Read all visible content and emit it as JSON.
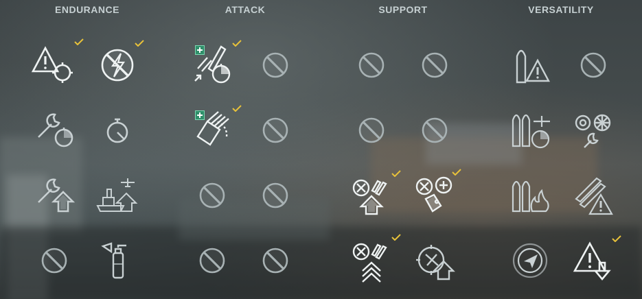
{
  "columns": [
    {
      "label": "ENDURANCE"
    },
    {
      "label": "ATTACK"
    },
    {
      "label": "SUPPORT"
    },
    {
      "label": "VERSATILITY"
    }
  ],
  "colors": {
    "header_text": "#c6d0d2",
    "icon_bright": "#eef2f2",
    "icon_dim": "#a8b2b4",
    "checkmark": "#e8c23a",
    "plus_badge": "#2f8f6a"
  },
  "skills": [
    {
      "name": "priority-target-skill",
      "icon": "warning-target-icon",
      "state": "learned"
    },
    {
      "name": "last-stand-skill",
      "icon": "crossed-lightning-icon",
      "state": "learned"
    },
    {
      "name": "skill-e-2-1",
      "icon": "wrench-timer-icon",
      "state": "available"
    },
    {
      "name": "skill-e-2-2",
      "icon": "stopwatch-icon",
      "state": "available"
    },
    {
      "name": "skill-e-3-1",
      "icon": "wrench-arrow-up-icon",
      "state": "available"
    },
    {
      "name": "skill-e-3-2",
      "icon": "ship-aircraft-arrow-up-icon",
      "state": "available"
    },
    {
      "name": "skill-e-4-1",
      "icon": "not-available-icon",
      "state": "unavailable"
    },
    {
      "name": "skill-e-4-2",
      "icon": "fire-extinguisher-icon",
      "state": "available"
    },
    {
      "name": "skill-a-1-1",
      "icon": "torpedo-timer-icon",
      "state": "learned_bonus"
    },
    {
      "name": "skill-a-1-2",
      "icon": "not-available-icon",
      "state": "unavailable"
    },
    {
      "name": "skill-a-2-1",
      "icon": "torpedo-launcher-icon",
      "state": "learned_bonus"
    },
    {
      "name": "skill-a-2-2",
      "icon": "not-available-icon",
      "state": "unavailable"
    },
    {
      "name": "skill-a-3-1",
      "icon": "not-available-icon",
      "state": "unavailable"
    },
    {
      "name": "skill-a-3-2",
      "icon": "not-available-icon",
      "state": "unavailable"
    },
    {
      "name": "skill-a-4-1",
      "icon": "not-available-icon",
      "state": "unavailable"
    },
    {
      "name": "skill-a-4-2",
      "icon": "not-available-icon",
      "state": "unavailable"
    },
    {
      "name": "skill-s-1-1",
      "icon": "not-available-icon",
      "state": "unavailable"
    },
    {
      "name": "skill-s-1-2",
      "icon": "not-available-icon",
      "state": "unavailable"
    },
    {
      "name": "skill-s-2-1",
      "icon": "not-available-icon",
      "state": "unavailable"
    },
    {
      "name": "skill-s-2-2",
      "icon": "not-available-icon",
      "state": "unavailable"
    },
    {
      "name": "skill-s-3-1",
      "icon": "aa-shells-arrow-up-icon",
      "state": "learned"
    },
    {
      "name": "skill-s-3-2",
      "icon": "aa-plus-tags-icon",
      "state": "learned"
    },
    {
      "name": "skill-s-4-1",
      "icon": "aa-shells-double-arrow-icon",
      "state": "learned"
    },
    {
      "name": "skill-s-4-2",
      "icon": "aircraft-crosshair-arrow-up-icon",
      "state": "available"
    },
    {
      "name": "skill-v-1-1",
      "icon": "shell-warning-icon",
      "state": "available"
    },
    {
      "name": "skill-v-1-2",
      "icon": "not-available-icon",
      "state": "unavailable"
    },
    {
      "name": "skill-v-2-1",
      "icon": "shells-aircraft-timer-icon",
      "state": "available"
    },
    {
      "name": "skill-v-2-2",
      "icon": "gears-wrench-icon",
      "state": "available"
    },
    {
      "name": "skill-v-3-1",
      "icon": "shells-fire-icon",
      "state": "available"
    },
    {
      "name": "skill-v-3-2",
      "icon": "torpedoes-warning-icon",
      "state": "available"
    },
    {
      "name": "skill-v-4-1",
      "icon": "radar-arrow-icon",
      "state": "available"
    },
    {
      "name": "skill-v-4-2",
      "icon": "warning-down-arrow-icon",
      "state": "learned"
    }
  ]
}
